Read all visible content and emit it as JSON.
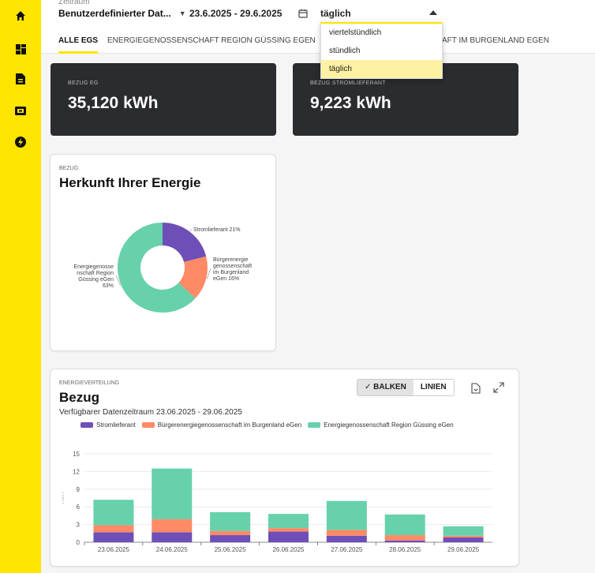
{
  "sidebar": {
    "icons": [
      "home-icon",
      "dashboard-icon",
      "document-icon",
      "wallet-icon",
      "energy-icon"
    ]
  },
  "topbar": {
    "zeitraum_label": "Zeitraum",
    "period_value": "Benutzerdefinierter Dat...",
    "date_range": "23.6.2025 - 29.6.2025",
    "interval_value": "täglich"
  },
  "dropdown": {
    "options": [
      "viertelstündlich",
      "stündlich",
      "täglich"
    ],
    "selected": "täglich"
  },
  "tabs": [
    {
      "label": "ALLE EGS",
      "active": true
    },
    {
      "label": "ENERGIEGENOSSENSCHAFT REGION GÜSSING EGEN",
      "active": false
    },
    {
      "label": "AFT IM BURGENLAND EGEN",
      "active": false
    }
  ],
  "kpis": [
    {
      "label": "BEZUG EG",
      "value": "35,120 kWh"
    },
    {
      "label": "BEZUG STROMLIEFERANT",
      "value": "9,223 kWh"
    }
  ],
  "herkunft": {
    "overline": "BEZUG",
    "title": "Herkunft Ihrer Energie",
    "segments": [
      {
        "label": "Stromlieferant 21%",
        "lines": [
          "Stromlieferant 21%"
        ],
        "value": 21,
        "color": "#6e4fb8"
      },
      {
        "label": "Bürgerenergie genossenschaft im Burgenland eGen 16%",
        "lines": [
          "Bürgerenergie",
          "genossenschaft",
          "im Burgenland",
          "eGen 16%"
        ],
        "value": 16,
        "color": "#ff8a65"
      },
      {
        "label": "Energiegenossenschaft Region Güssing eGen 63%",
        "lines": [
          "Energiegenosse",
          "nschaft Region",
          "Güssing eGen",
          "63%"
        ],
        "value": 63,
        "color": "#66d1aa"
      }
    ]
  },
  "verteilung": {
    "overline": "ENERGIEVERTEILUNG",
    "title": "Bezug",
    "subtitle": "Verfügbarer Datenzeitraum 23.06.2025 - 29.06.2025",
    "toggle": {
      "balken": "✓ BALKEN",
      "linien": "LINIEN"
    }
  },
  "chart_data": {
    "type": "bar",
    "stacked": true,
    "categories": [
      "23.06.2025",
      "24.06.2025",
      "25.06.2025",
      "26.06.2025",
      "27.06.2025",
      "28.06.2025",
      "29.06.2025"
    ],
    "series": [
      {
        "name": "Stromlieferant",
        "color": "#6e4fb8",
        "values": [
          1.7,
          1.7,
          1.2,
          1.8,
          1.1,
          0.3,
          0.8
        ]
      },
      {
        "name": "Bürgerenergiegenossenschaft im Burgenland eGen",
        "color": "#ff8a65",
        "values": [
          1.2,
          2.2,
          0.7,
          0.6,
          1.0,
          0.9,
          0.3
        ]
      },
      {
        "name": "Energiegenossenschaft Region Güssing eGen",
        "color": "#66d1aa",
        "values": [
          4.3,
          8.6,
          3.2,
          2.4,
          4.9,
          3.5,
          1.6
        ]
      }
    ],
    "yticks": [
      0,
      3,
      6,
      9,
      12,
      15
    ],
    "ylim": [
      0,
      15
    ],
    "ylabel": "",
    "grid": true,
    "legend": "top"
  }
}
